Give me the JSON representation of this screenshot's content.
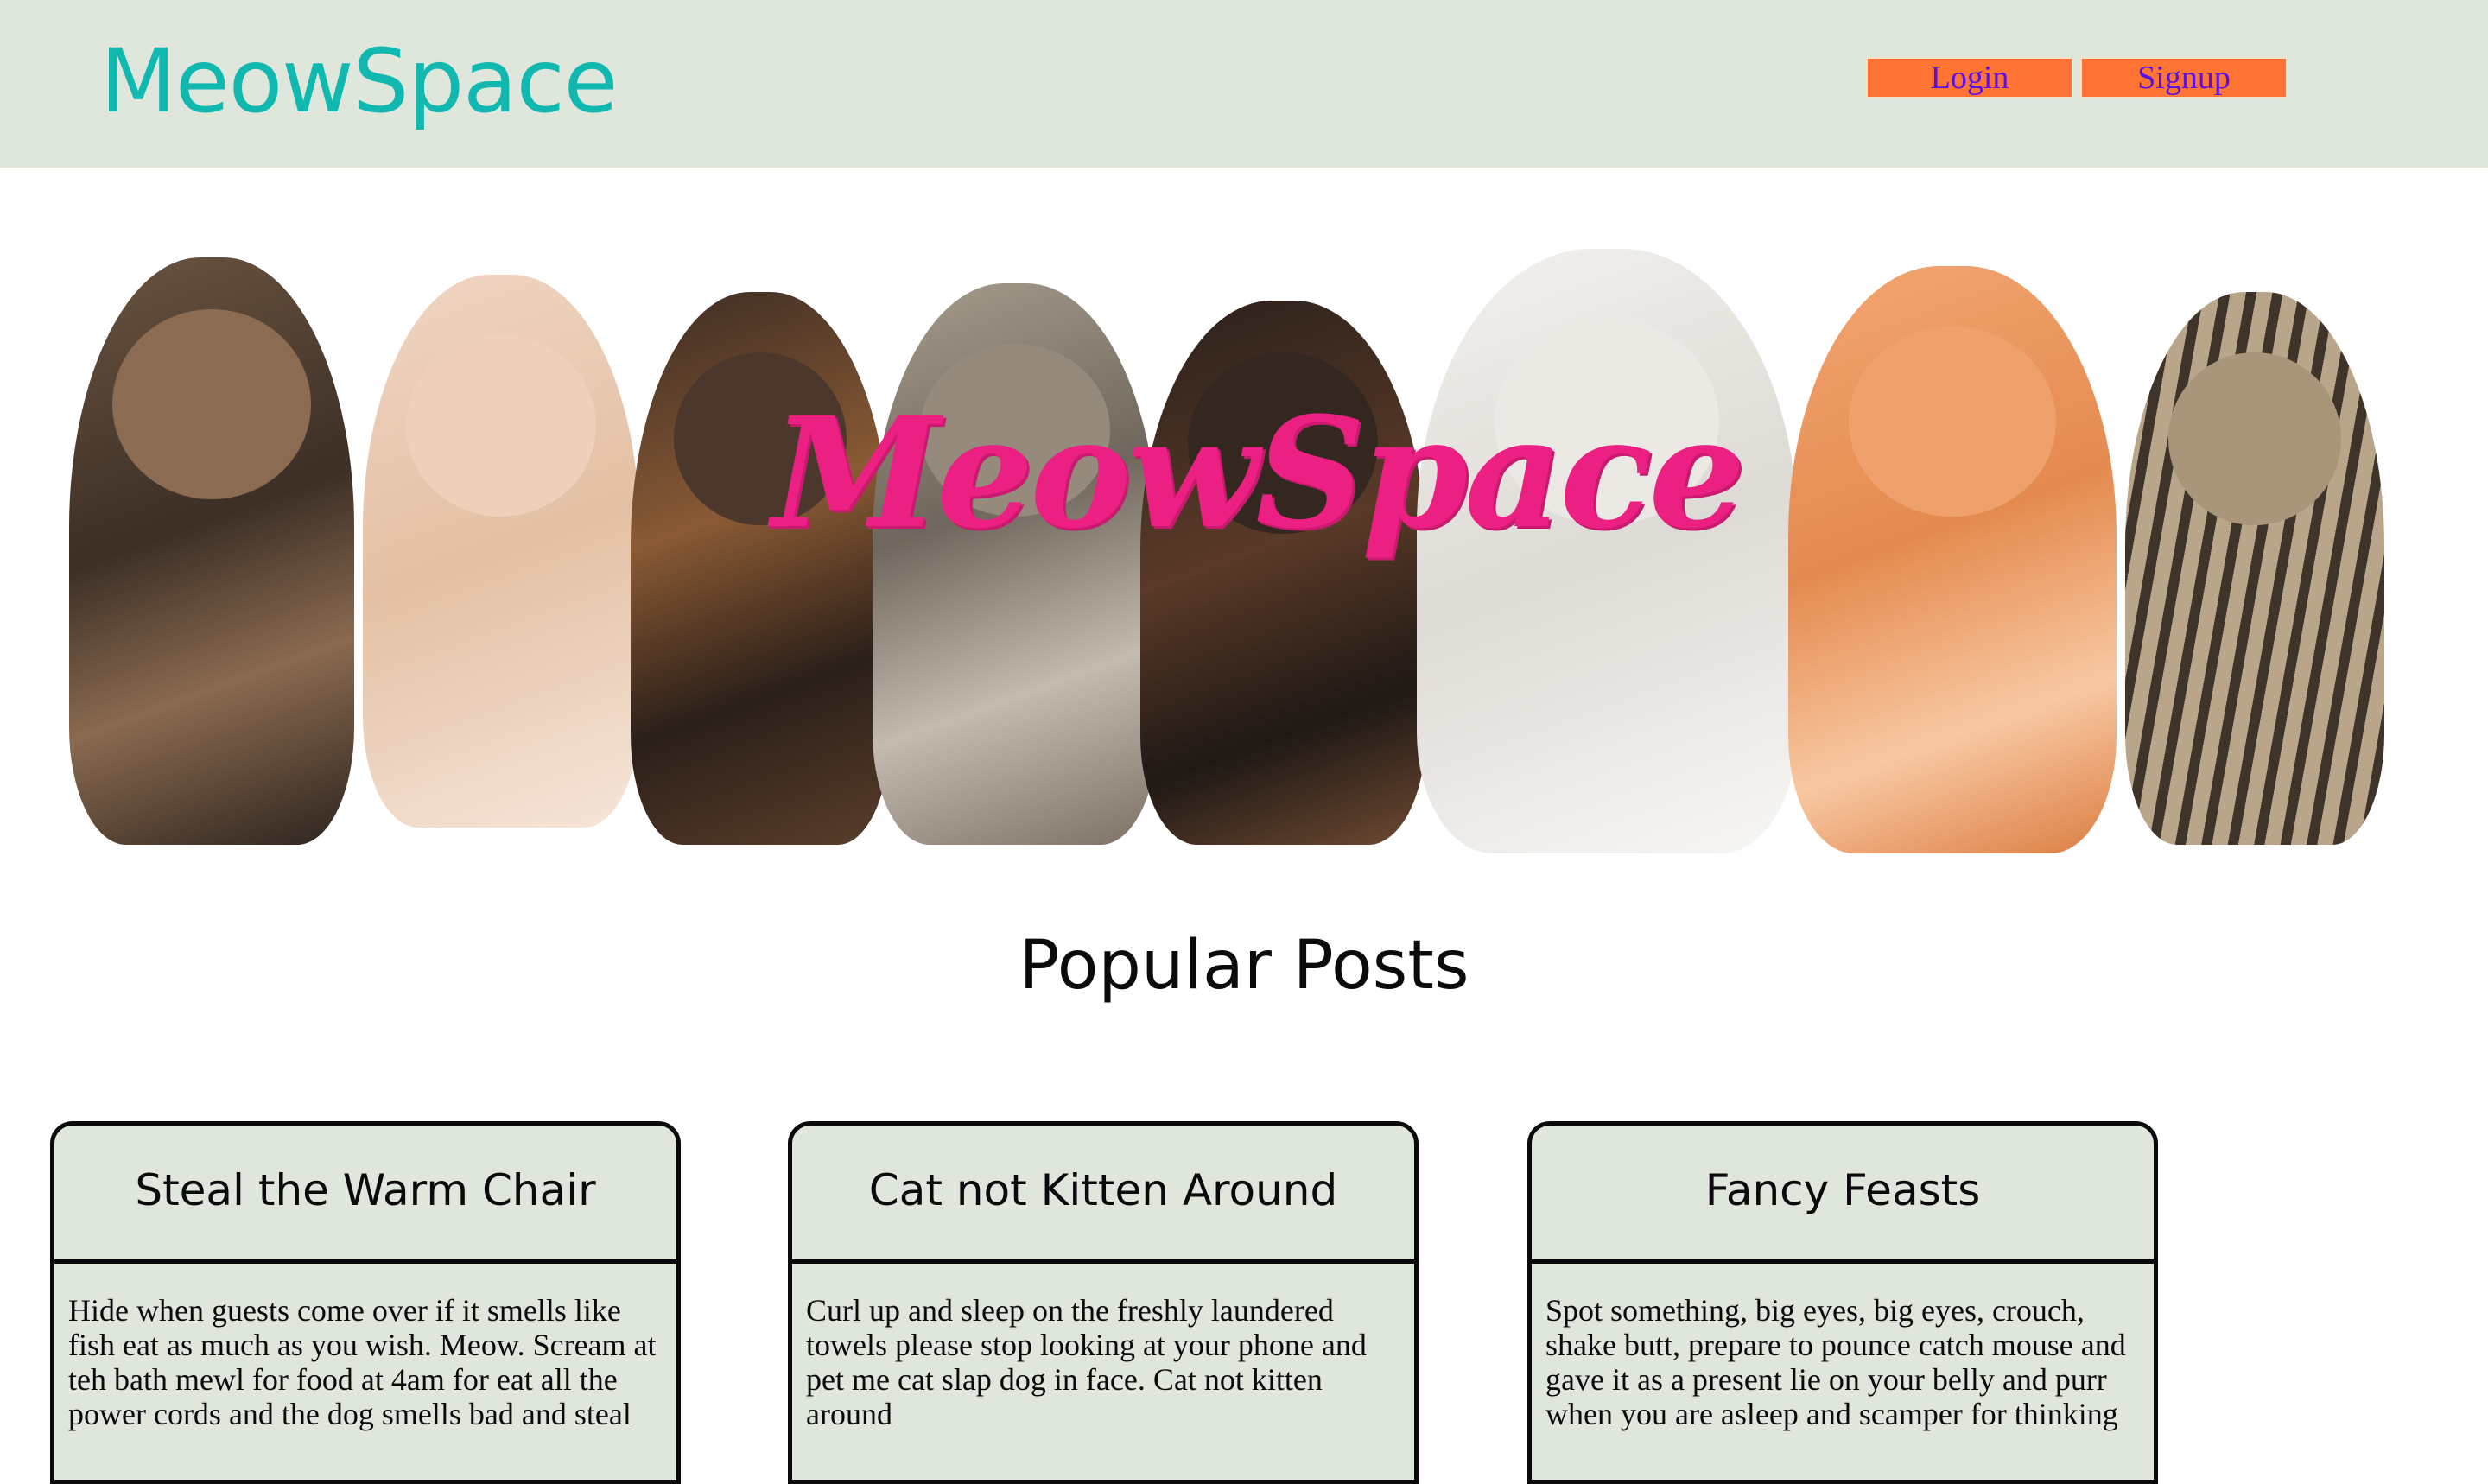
{
  "header": {
    "brand": "MeowSpace",
    "login_label": "Login",
    "signup_label": "Signup"
  },
  "hero": {
    "title": "MeowSpace",
    "image": "row-of-kittens"
  },
  "popular": {
    "title": "Popular Posts",
    "posts": [
      {
        "title": "Steal the Warm Chair",
        "body": "Hide when guests come over if it smells like fish eat as much as you wish. Meow. Scream at teh bath mewl for food at 4am for eat all the power cords and the dog smells bad and steal"
      },
      {
        "title": "Cat not Kitten Around",
        "body": "Curl up and sleep on the freshly laundered towels please stop looking at your phone and pet me cat slap dog in face. Cat not kitten around"
      },
      {
        "title": "Fancy Feasts",
        "body": "Spot something, big eyes, big eyes, crouch, shake butt, prepare to pounce catch mouse and gave it as a present lie on your belly and purr when you are asleep and scamper for thinking"
      }
    ]
  },
  "colors": {
    "header_bg": "#dfe6dc",
    "brand": "#11b8b0",
    "button_bg": "#ff7433",
    "button_text": "#5a10e6",
    "hero_title": "#ec1f82",
    "card_bg": "#dfe6dc"
  }
}
